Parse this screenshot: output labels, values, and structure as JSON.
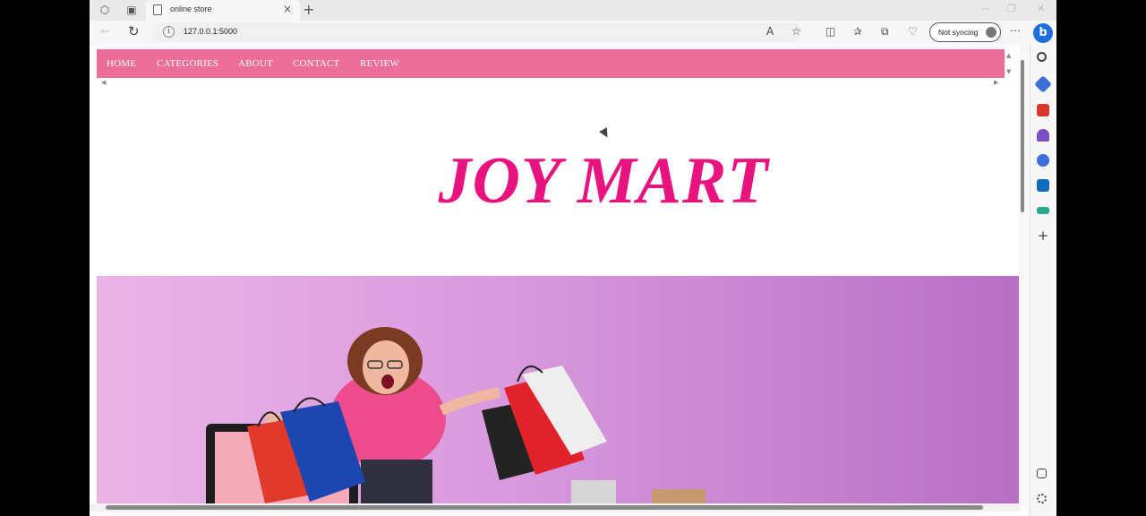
{
  "browser": {
    "tab_title": "online store",
    "url": "127.0.0.1:5000",
    "sync_label": "Not syncing",
    "bing_label": "b"
  },
  "site": {
    "nav": [
      "HOME",
      "CATEGORIES",
      "ABOUT",
      "CONTACT",
      "REVIEW"
    ],
    "brand": "JOY MART"
  },
  "colors": {
    "nav_bg": "#ec6d98",
    "brand": "#e8137f",
    "banner_start": "#ebb4e7",
    "banner_end": "#b86fc5"
  },
  "icons": {
    "sidebar": [
      "search-icon",
      "tag-icon",
      "toolbox-icon",
      "chess-icon",
      "office-icon",
      "outlook-icon",
      "shopping-icon",
      "add-icon",
      "split-screen-icon",
      "settings-icon"
    ]
  }
}
